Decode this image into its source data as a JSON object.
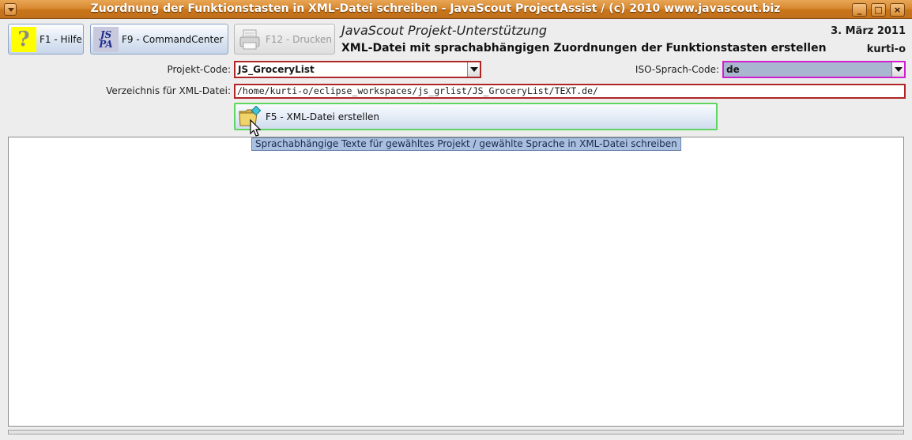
{
  "window": {
    "title": "Zuordnung der Funktionstasten in XML-Datei schreiben - JavaScout ProjectAssist / (c) 2010 www.javascout.biz",
    "controls": {
      "minimize": "_",
      "maximize": "□",
      "close": "×"
    }
  },
  "toolbar": {
    "help_label": "F1 - Hilfe",
    "help_icon_glyph": "?",
    "commandcenter_label": "F9 - CommandCenter",
    "commandcenter_icon_line1": "JS",
    "commandcenter_icon_line2": "PA",
    "print_label": "F12 - Drucken"
  },
  "header": {
    "subtitle": "JavaScout Projekt-Unterstützung",
    "title": "XML-Datei mit sprachabhängigen Zuordnungen der Funktionstasten erstellen",
    "date": "3. März 2011",
    "user": "kurti-o"
  },
  "form": {
    "project_code_label": "Projekt-Code:",
    "project_code_value": "JS_GroceryList",
    "iso_code_label": "ISO-Sprach-Code:",
    "iso_code_value": "de",
    "directory_label": "Verzeichnis für XML-Datei:",
    "directory_value": "/home/kurti-o/eclipse_workspaces/js_grlist/JS_GroceryList/TEXT.de/"
  },
  "action": {
    "create_label": "F5 - XML-Datei erstellen",
    "tooltip": "Sprachabhängige Texte für gewähltes Projekt / gewählte Sprache in XML-Datei schreiben"
  },
  "output_text": "",
  "colors": {
    "title_bar": "#d98a32",
    "mandatory_border": "#b02626",
    "selected_border": "#d01ed0",
    "action_border": "#5fd65f",
    "tooltip_bg": "#a9bfe0"
  }
}
